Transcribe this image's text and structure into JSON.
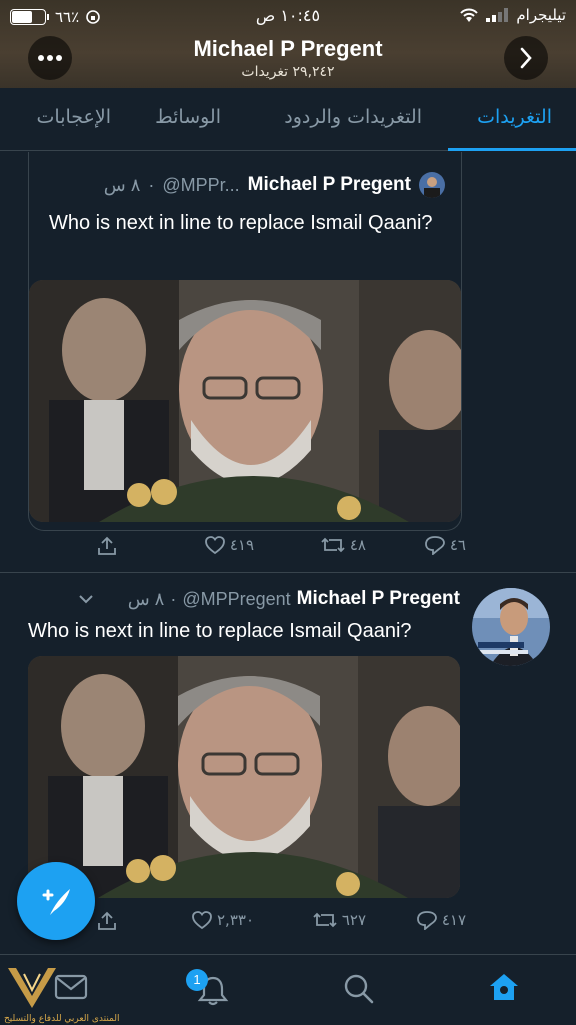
{
  "status": {
    "battery": "٦٦٪",
    "battery_level": 0.66,
    "time": "١٠:٤٥ ص",
    "carrier": "تيليجرام"
  },
  "header": {
    "name": "Michael P Pregent",
    "tweet_count": "٢٩,٢٤٢ تغريدات"
  },
  "tabs": [
    "التغريدات",
    "التغريدات والردود",
    "الوسائط",
    "الإعجابات"
  ],
  "quoted_tweet": {
    "name": "Michael P Pregent",
    "handle": "@MPPr...",
    "time": "٨ س",
    "text": "Who is next in line to replace Ismail Qaani?",
    "replies": "٤٦",
    "retweets": "٤٨",
    "likes": "٤١٩"
  },
  "tweet": {
    "name": "Michael P Pregent",
    "handle": "@MPPregent",
    "time": "٨ س",
    "text": "Who is next in line to replace Ismail Qaani?",
    "replies": "٤١٧",
    "retweets": "٦٢٧",
    "likes": "٢,٣٣٠"
  },
  "nav": {
    "notifications_badge": "1"
  },
  "watermark": "المنتدى العربي للدفاع والتسليح",
  "colors": {
    "background": "#15202b",
    "accent": "#1da1f2",
    "muted": "#8899a6",
    "border": "#38444d"
  }
}
